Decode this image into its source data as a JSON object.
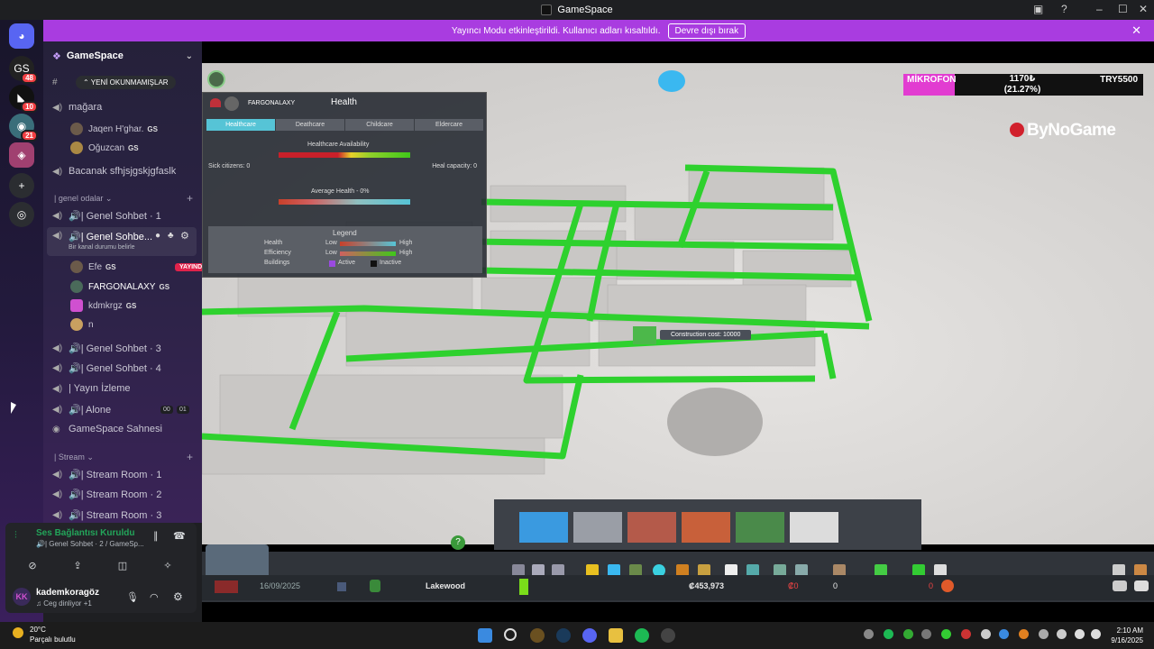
{
  "window": {
    "title": "GameSpace",
    "buttons": [
      "cast",
      "help",
      "minimize",
      "maximize",
      "close"
    ]
  },
  "banner": {
    "text": "Yayıncı Modu etkinleştirildi. Kullanıcı adları kısaltıldı.",
    "button": "Devre dışı bırak"
  },
  "rail": {
    "badges": [
      "48",
      "10",
      "21"
    ]
  },
  "sidebar": {
    "server_name": "GameSpace",
    "unread_pill": "YENİ OKUNMAMIŞLAR",
    "channels_top": [
      {
        "label": "mağara"
      },
      {
        "label": "Bacanak sfhjsjgskjgfaslk"
      }
    ],
    "magara_users": [
      {
        "name": "Jaqen H'ghar.",
        "tag": "GS"
      },
      {
        "name": "Oğuzcan",
        "tag": "GS"
      }
    ],
    "category_genel": "| genel odalar",
    "genel_channels": [
      {
        "label": "🔊| Genel Sohbet · 1"
      },
      {
        "label": "🔊| Genel Sohbe...",
        "status": "Bir kanal durumu belirle"
      },
      {
        "label": "🔊| Genel Sohbet · 3"
      },
      {
        "label": "🔊| Genel Sohbet · 4"
      },
      {
        "label": "| Yayın İzleme"
      },
      {
        "label": "🔊| Alone",
        "counts": [
          "00",
          "01"
        ]
      },
      {
        "label": "GameSpace Sahnesi"
      }
    ],
    "voice_users": [
      {
        "name": "Efe",
        "tag": "GS",
        "live": "YAYINDA"
      },
      {
        "name": "FARGONALAXY",
        "tag": "GS"
      },
      {
        "name": "kdmkrgz",
        "tag": "GS"
      },
      {
        "name": "n"
      }
    ],
    "category_stream": "| Stream",
    "stream_channels": [
      {
        "label": "🔊| Stream Room · 1"
      },
      {
        "label": "🔊| Stream Room · 2"
      },
      {
        "label": "🔊| Stream Room · 3"
      }
    ]
  },
  "voice_panel": {
    "status": "Ses Bağlantısı Kuruldu",
    "channel": "🔊| Genel Sohbet · 2 / GameSp...",
    "user": "kademkoragöz",
    "user_status": "♫ Ceg dinliyor +1"
  },
  "game": {
    "health_panel": {
      "title": "Health",
      "player": "FARGONALAXY",
      "tabs": [
        "Healthcare",
        "Deathcare",
        "Childcare",
        "Eldercare"
      ],
      "availability": "Healthcare Availability",
      "sick": "Sick citizens: 0",
      "heal": "Heal capacity: 0",
      "avg": "Average Health - 0%",
      "legend_title": "Legend",
      "legend_rows": [
        {
          "label": "Health",
          "low": "Low",
          "high": "High"
        },
        {
          "label": "Efficiency",
          "low": "Low",
          "high": "High"
        },
        {
          "label": "Buildings",
          "low": "Active",
          "high": "Inactive"
        }
      ]
    },
    "mic": {
      "label": "MİKROFON",
      "amount": "1170₺",
      "pct": "(21.27%)",
      "goal": "TRY5500"
    },
    "brand": "ByNoGame",
    "construction": "Construction cost: 10000",
    "hud": {
      "date": "16/09/2025",
      "city": "Lakewood",
      "money": "₡453,973",
      "income": "₡0",
      "population": "0",
      "pop_right": "0"
    },
    "colors": {
      "road": "#2ed12e",
      "panel": "#2c3038",
      "accent": "#56c4d6"
    }
  },
  "taskbar": {
    "temp": "20°C",
    "weather": "Parçalı bulutlu",
    "time": "2:10 AM",
    "date": "9/16/2025"
  }
}
